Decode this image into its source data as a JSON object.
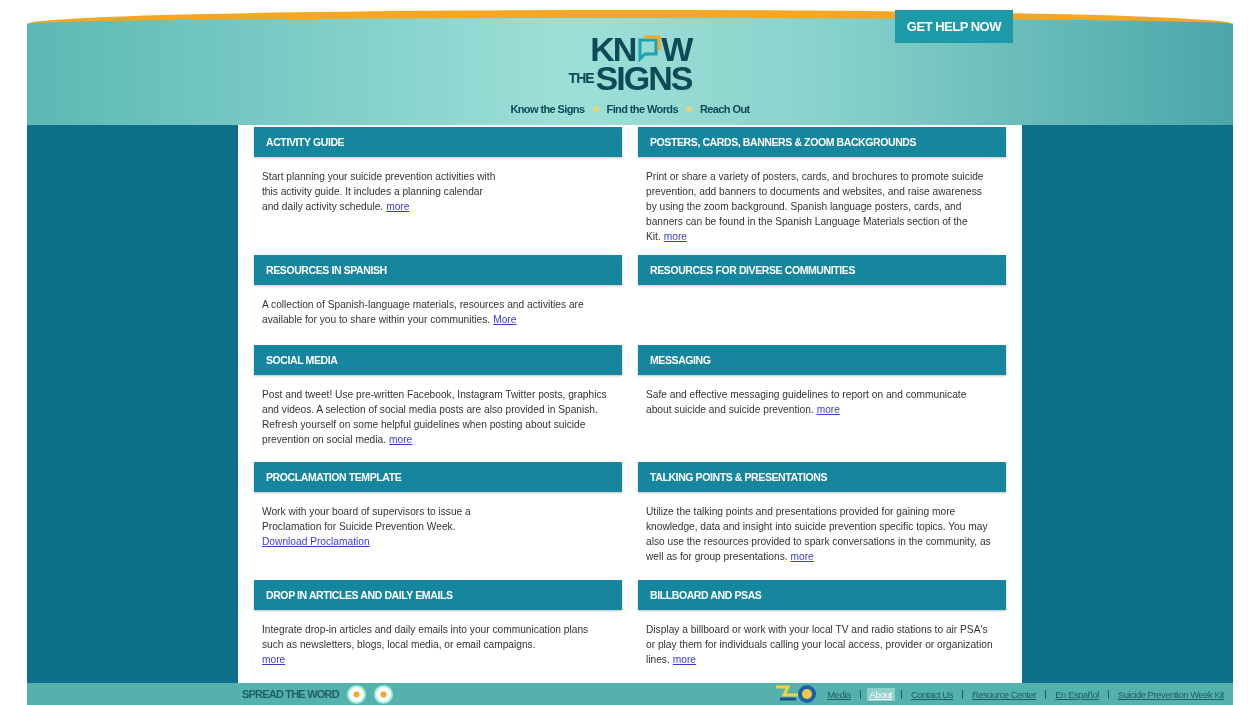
{
  "header": {
    "logo": {
      "before": "KN",
      "after": "W",
      "small": "THE",
      "big": "SIGNS"
    },
    "help_button": "GET HELP NOW",
    "nav": [
      "Know the Signs",
      "Find the Words",
      "Reach Out"
    ]
  },
  "sections": [
    {
      "title": "ACTIVITY GUIDE",
      "text": "Start planning your suicide prevention activities with\nthis activity guide. It includes a planning calendar\nand daily activity schedule.",
      "link": "more",
      "kind": "inline"
    },
    {
      "title": "POSTERS, CARDS, BANNERS & ZOOM BACKGROUNDS",
      "text": "Print or share a variety of posters, cards, and brochures to promote suicide prevention, add banners to documents and websites, and raise awareness by using the zoom background. Spanish language posters, cards, and banners can be found in the Spanish Language Materials section of the Kit.",
      "link": "more",
      "kind": "inline"
    },
    {
      "title": "RESOURCES IN SPANISH",
      "text": "A collection of Spanish-language materials, resources and activities are available for you to share within your communities.",
      "link": "More",
      "kind": "inline"
    },
    {
      "title": "RESOURCES FOR DIVERSE COMMUNITIES",
      "kind": "heading"
    },
    {
      "title": "SOCIAL MEDIA",
      "text": "Post and tweet! Use pre-written Facebook, Instagram Twitter posts, graphics and videos. A selection of social media posts are also provided in Spanish. Refresh yourself on some helpful guidelines when posting about suicide prevention on social media.",
      "link": "more",
      "kind": "inline"
    },
    {
      "title": "MESSAGING",
      "text": "Safe and effective messaging guidelines to report on and communicate about suicide and suicide prevention.",
      "link": "more",
      "kind": "inline"
    },
    {
      "title": "PROCLAMATION TEMPLATE",
      "text": "Work with your board of supervisors to issue a\nProclamation for Suicide Prevention Week.",
      "link": "Download Proclamation",
      "kind": "below"
    },
    {
      "title": "TALKING POINTS & PRESENTATIONS",
      "text": "Utilize the talking points and presentations provided for gaining more knowledge, data and insight into suicide prevention specific topics. You may also use the resources provided to spark conversations in the community, as well as for group presentations.",
      "link": "more",
      "kind": "inline"
    },
    {
      "title": "DROP IN ARTICLES AND DAILY EMAILS",
      "text": "Integrate drop-in articles and daily emails into your communication plans such as newsletters, blogs, local media, or email campaigns.",
      "link": "more",
      "kind": "below"
    },
    {
      "title": "BILLBOARD AND PSAS",
      "text": "Display a billboard or work with your local TV and radio stations to air PSA's or play them for individuals calling your local access, provider or organization lines.",
      "link": "more",
      "kind": "inline"
    }
  ],
  "footer": {
    "spread": "SPREAD THE WORD",
    "links": [
      {
        "label": "Media",
        "selected": false
      },
      {
        "label": "About",
        "selected": true
      },
      {
        "label": "Contact Us",
        "selected": false
      },
      {
        "label": "Resource Center",
        "selected": false
      },
      {
        "label": "En Español",
        "selected": false
      },
      {
        "label": "Suicide Prevention Week Kit",
        "selected": false
      }
    ]
  }
}
